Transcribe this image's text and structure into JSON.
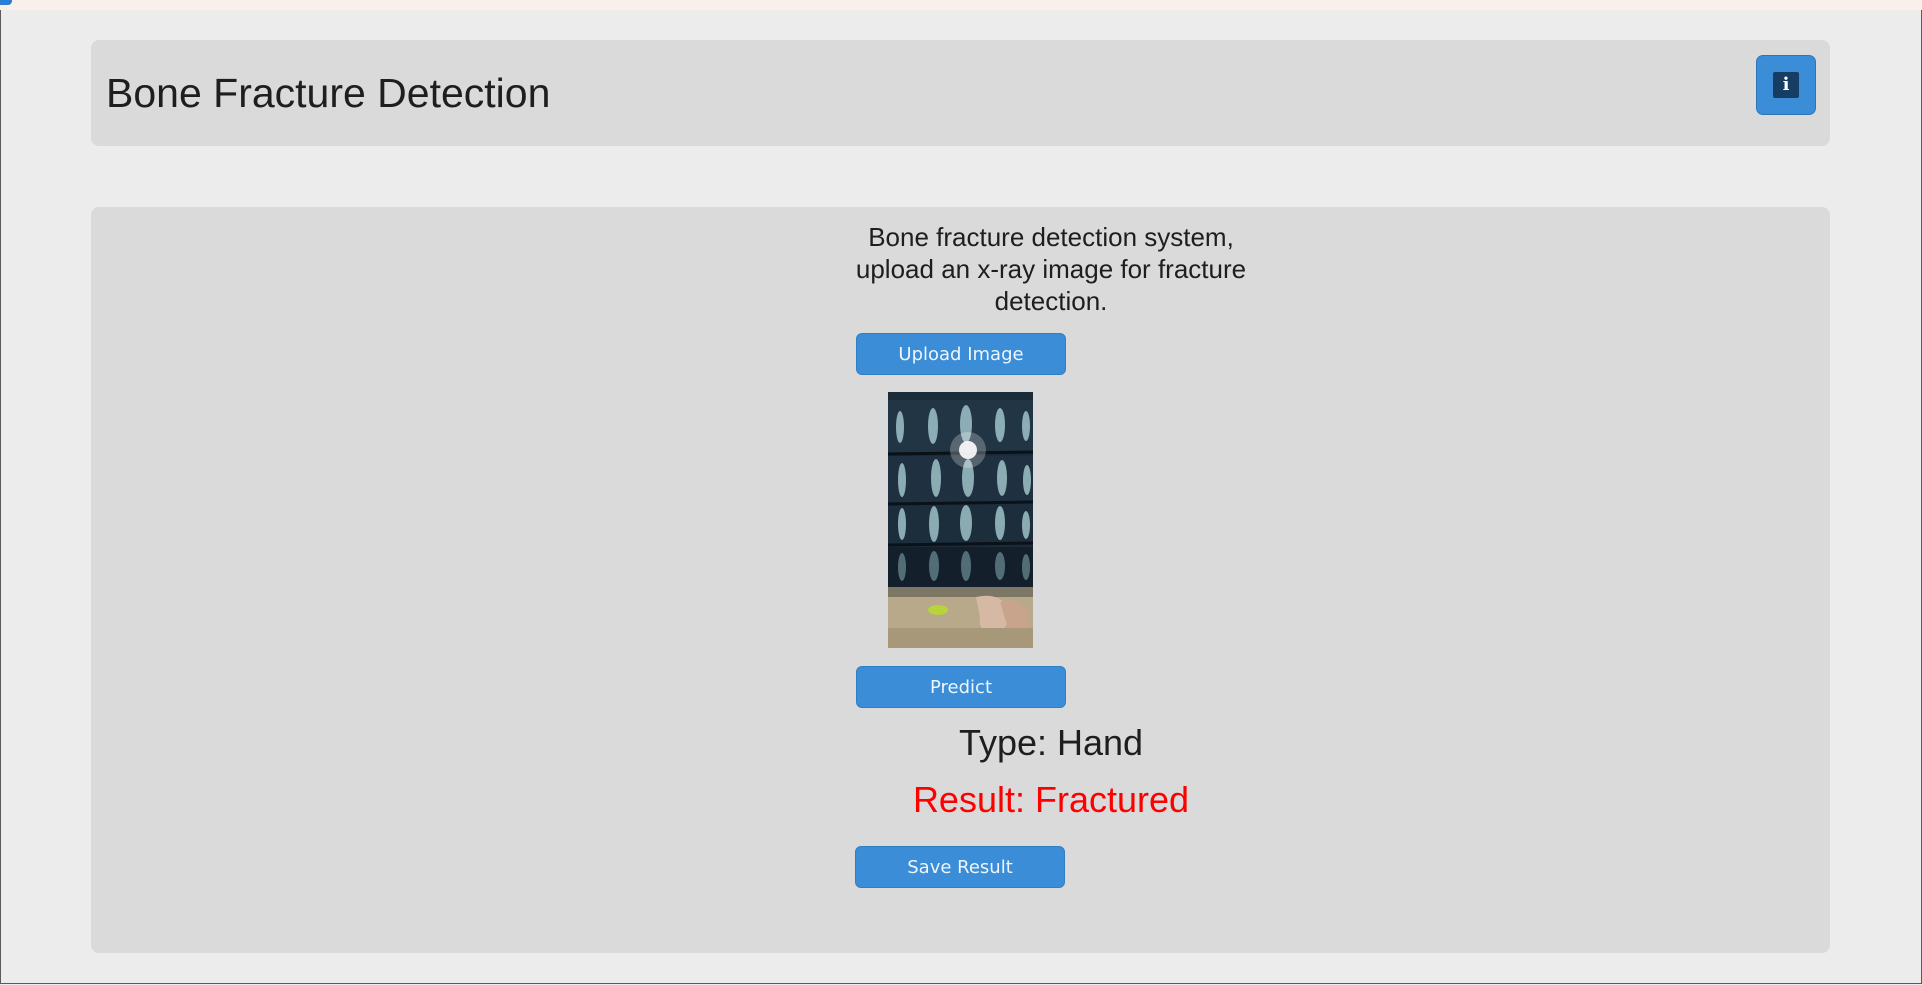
{
  "header": {
    "title": "Bone Fracture Detection",
    "info_icon": "info-icon"
  },
  "main": {
    "description_lines": [
      "Bone fracture detection system,",
      "upload an x-ray image for fracture",
      "detection."
    ],
    "upload_label": "Upload Image",
    "predict_label": "Predict",
    "type_text": "Type: Hand",
    "result_text": "Result: Fractured",
    "save_label": "Save Result"
  },
  "colors": {
    "accent": "#3a8dd6",
    "result": "#ff0000",
    "panel": "#dadada",
    "background": "#ececec"
  }
}
